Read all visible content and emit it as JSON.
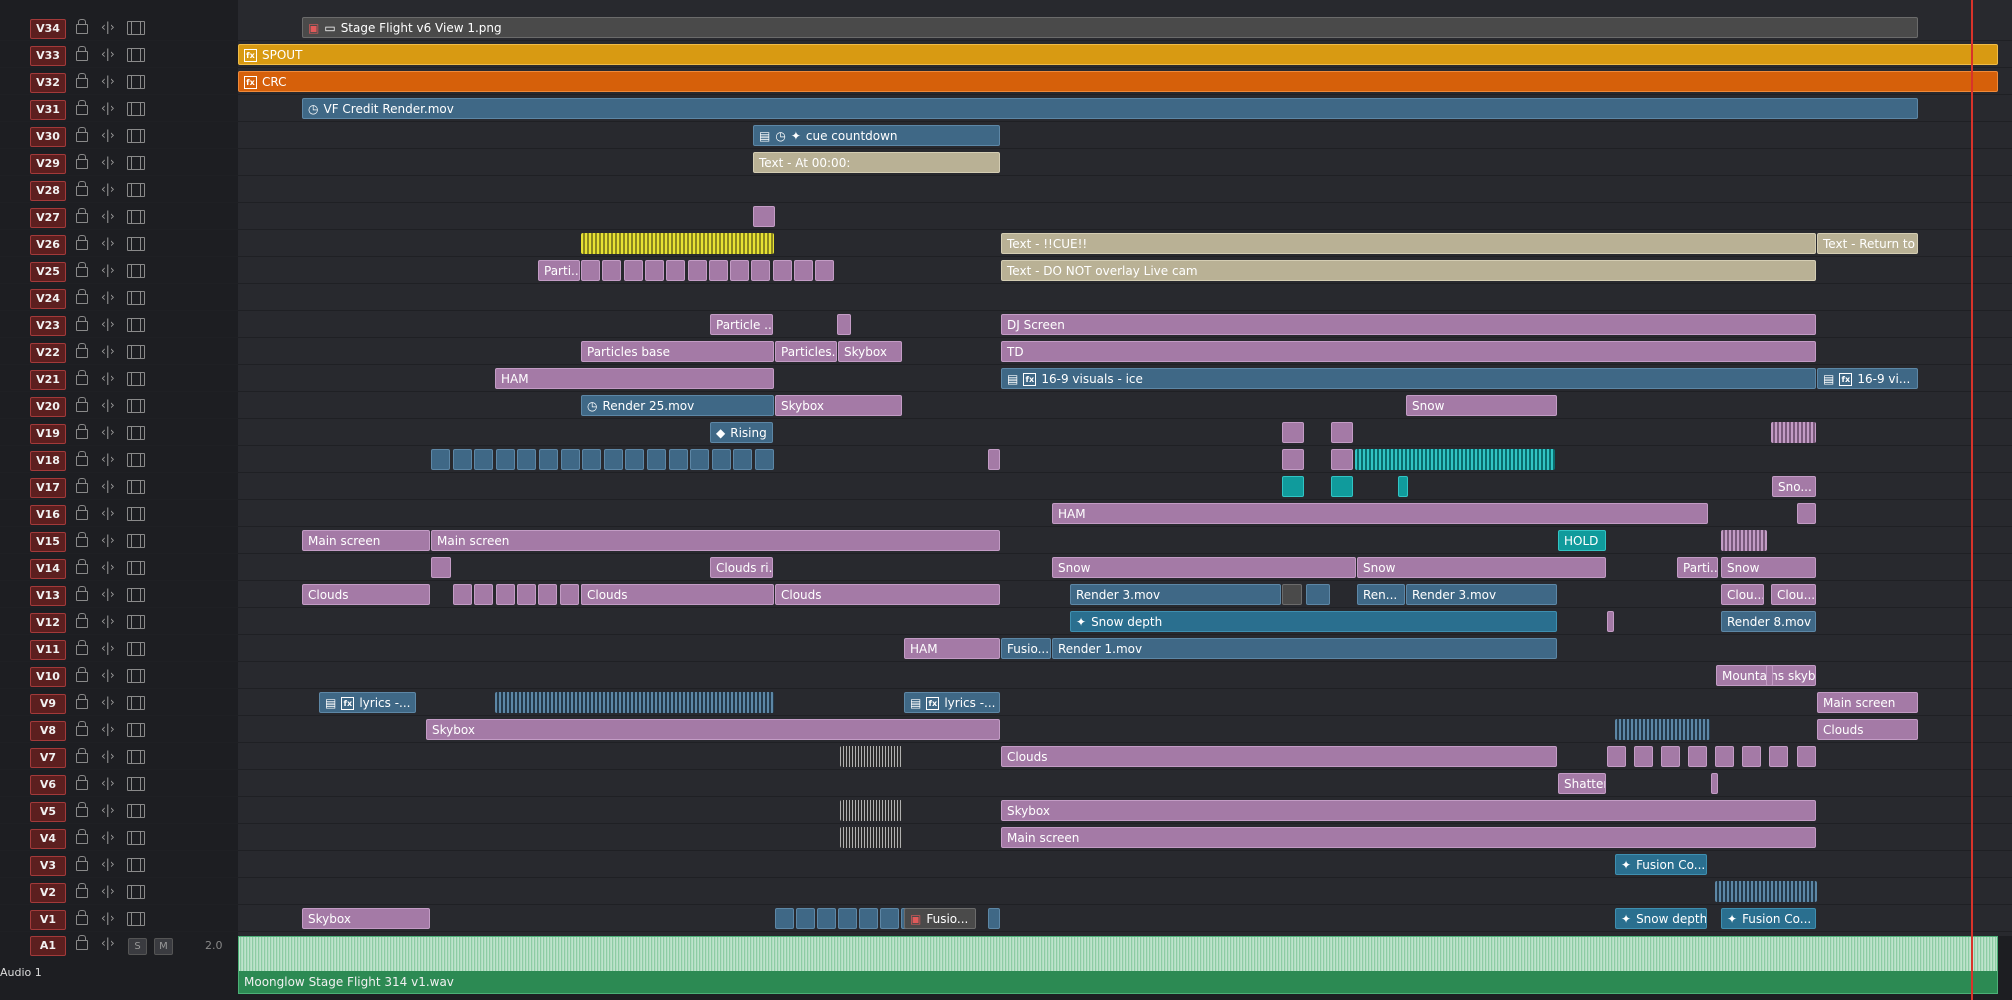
{
  "tracks": [
    "V34",
    "V33",
    "V32",
    "V31",
    "V30",
    "V29",
    "V28",
    "V27",
    "V26",
    "V25",
    "V24",
    "V23",
    "V22",
    "V21",
    "V20",
    "V19",
    "V18",
    "V17",
    "V16",
    "V15",
    "V14",
    "V13",
    "V12",
    "V11",
    "V10",
    "V9",
    "V8",
    "V7",
    "V6",
    "V5",
    "V4",
    "V3",
    "V2",
    "V1"
  ],
  "audio": {
    "badge": "A1",
    "name": "Audio 1",
    "solo_label": "S",
    "mute_label": "M",
    "channels": "2.0",
    "clip_name": "Moonglow Stage Flight 314 v1.wav"
  },
  "colors": {
    "purple": "#a47aa6",
    "blue": "#3f6886",
    "teal": "#109b9c",
    "tan": "#b9b195",
    "orange": "#d6600a",
    "gold": "#d89a12",
    "audio_green": "#2c8a53",
    "playhead": "#d8332a"
  },
  "clips": {
    "v34_1": "Stage Flight v6 View 1.png",
    "v33_1": "SPOUT",
    "v32_1": "CRC",
    "v31_1": "VF Credit Render.mov",
    "v30_1": "cue countdown",
    "v29_1": "Text - At 00:00:",
    "v26_1": "Text - !!CUE!!",
    "v26_2": "Text - Return to ...",
    "v25_1": "Parti...",
    "v25_2": "Text - DO NOT overlay Live cam",
    "v23_1": "Particle ...",
    "v23_2": "DJ Screen",
    "v22_1": "Particles base",
    "v22_2": "Particles...",
    "v22_3": "Skybox",
    "v22_4": "TD",
    "v21_1": "HAM",
    "v21_2": "16-9 visuals - ice",
    "v21_3": "16-9 vi...",
    "v20_1": "Render 25.mov",
    "v20_2": "Skybox",
    "v20_3": "Snow",
    "v19_1": "Rising",
    "v17_1": "Sno...",
    "v16_1": "HAM",
    "v15_1": "Main screen",
    "v15_2": "Main screen",
    "v15_3": "HOLD",
    "v14_1": "Clouds ri...",
    "v14_2": "Snow",
    "v14_3": "Snow",
    "v14_4": "Parti...",
    "v14_5": "Snow",
    "v13_1": "Clouds",
    "v13_2": "Clouds",
    "v13_3": "Clouds",
    "v13_4": "Render 3.mov",
    "v13_5": "Ren...",
    "v13_6": "Render 3.mov",
    "v13_7": "Clou...",
    "v13_8": "Clou...",
    "v12_1": "Snow depth",
    "v12_2": "Render 8.mov",
    "v11_1": "HAM",
    "v11_2": "Fusio...",
    "v11_3": "Render 1.mov",
    "v10_1": "Mountains skyb...",
    "v9_1": "lyrics -...",
    "v9_2": "lyrics -...",
    "v9_3": "Main screen",
    "v8_1": "Skybox",
    "v8_2": "Clouds",
    "v7_1": "Clouds",
    "v6_1": "Shatter",
    "v5_1": "Skybox",
    "v4_1": "Main screen",
    "v3_1": "Fusion Co...",
    "v1_1": "Skybox",
    "v1_2": "Fusio...",
    "v1_3": "Snow depth",
    "v1_4": "Fusion Co..."
  }
}
